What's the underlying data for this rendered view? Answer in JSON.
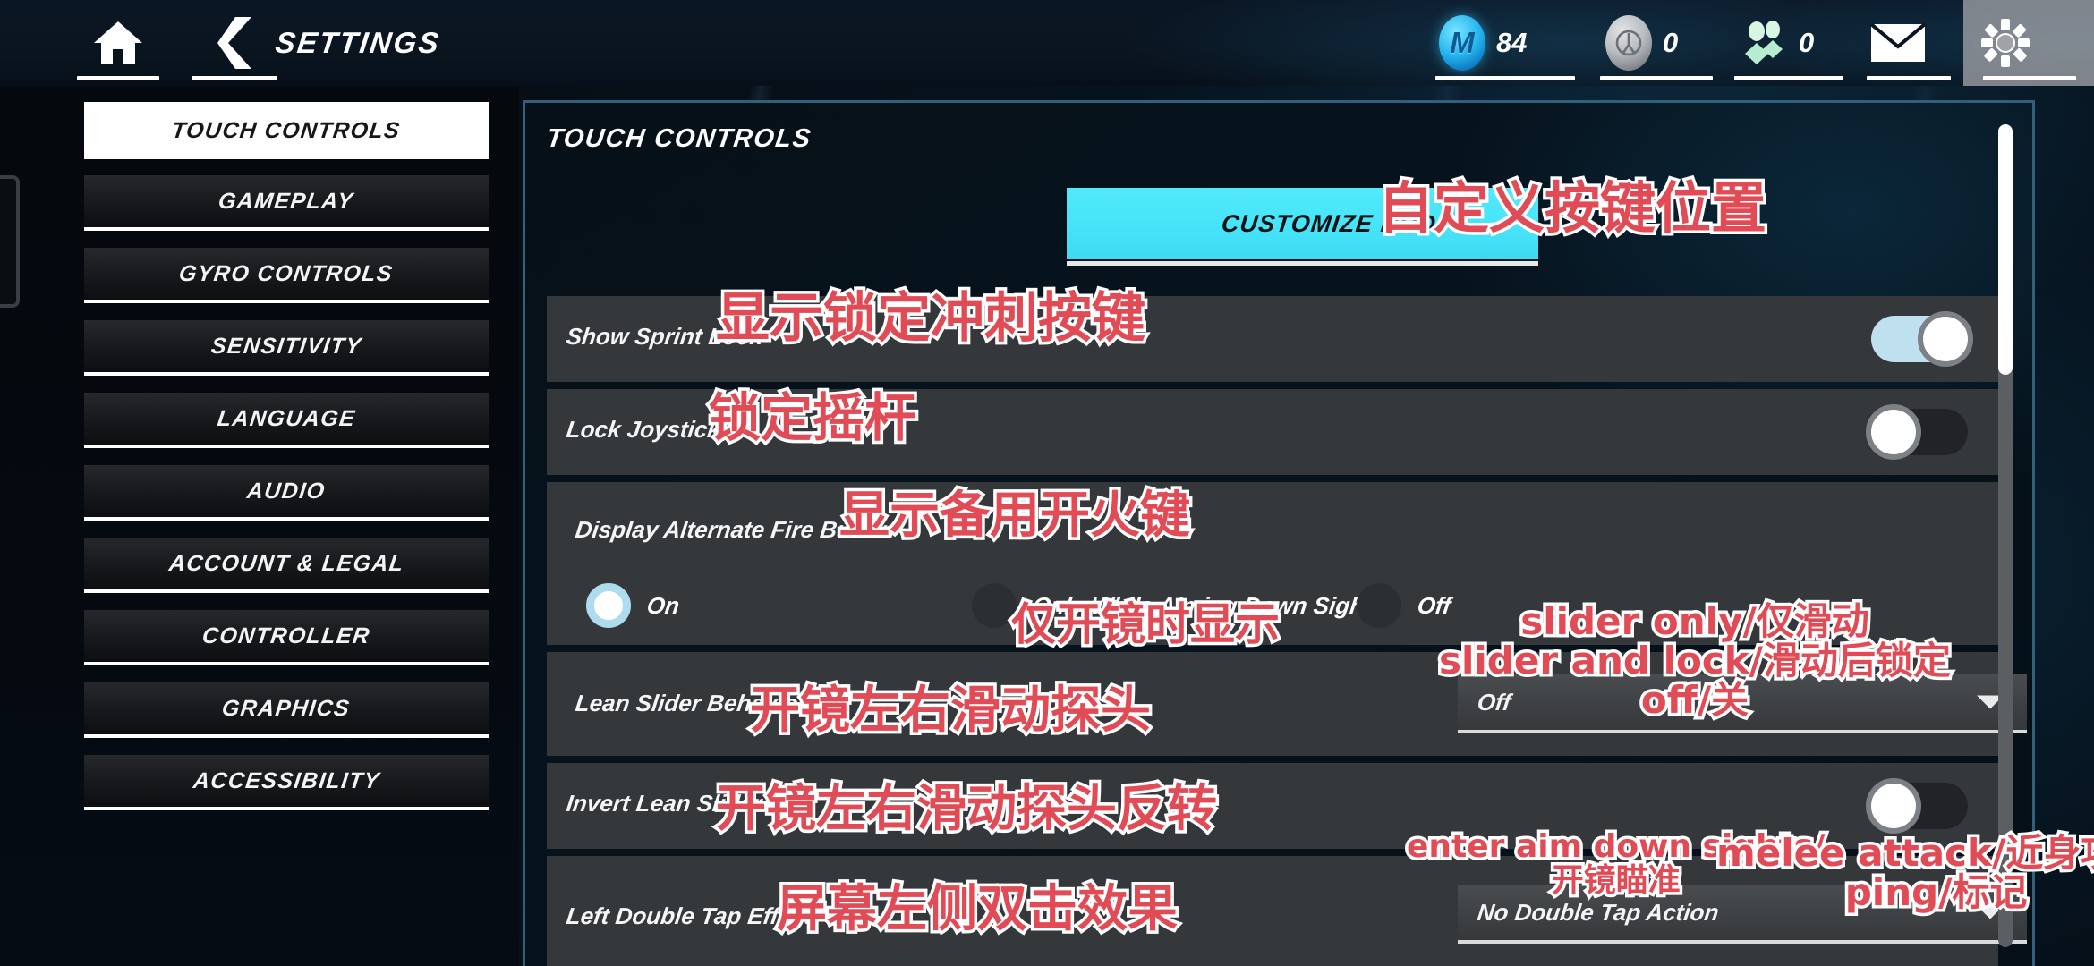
{
  "topbar": {
    "home_icon": "home-icon",
    "back_icon": "back-chevron-icon",
    "title": "SETTINGS",
    "currencies": [
      {
        "id": "credits",
        "icon": "m-credit-coin-icon",
        "glyph": "M",
        "value": "84"
      },
      {
        "id": "tokens",
        "icon": "r6-token-coin-icon",
        "glyph": "",
        "value": "0"
      },
      {
        "id": "friends",
        "icon": "friends-icon",
        "glyph": "",
        "value": "0"
      },
      {
        "id": "mail",
        "icon": "mail-envelope-icon",
        "glyph": "",
        "value": ""
      },
      {
        "id": "gear",
        "icon": "gear-icon",
        "glyph": "",
        "value": ""
      }
    ]
  },
  "sidebar": {
    "items": [
      {
        "label": "TOUCH CONTROLS",
        "active": true
      },
      {
        "label": "GAMEPLAY",
        "active": false
      },
      {
        "label": "GYRO CONTROLS",
        "active": false
      },
      {
        "label": "SENSITIVITY",
        "active": false
      },
      {
        "label": "LANGUAGE",
        "active": false
      },
      {
        "label": "AUDIO",
        "active": false
      },
      {
        "label": "ACCOUNT & LEGAL",
        "active": false
      },
      {
        "label": "CONTROLLER",
        "active": false
      },
      {
        "label": "GRAPHICS",
        "active": false
      },
      {
        "label": "ACCESSIBILITY",
        "active": false
      }
    ]
  },
  "main": {
    "panel_title": "TOUCH CONTROLS",
    "customize_hud_label": "CUSTOMIZE HUD",
    "rows": {
      "show_sprint_lock": {
        "label": "Show Sprint Lock",
        "toggle": "on"
      },
      "lock_joystick": {
        "label": "Lock Joystick",
        "toggle": "off"
      },
      "display_alternate_fire": {
        "label": "Display Alternate Fire Button",
        "options": [
          {
            "label": "On",
            "selected": true
          },
          {
            "label": "Only While Aiming Down Sight",
            "selected": false
          },
          {
            "label": "Off",
            "selected": false
          }
        ]
      },
      "lean_slider_behavior": {
        "label": "Lean Slider Behavior",
        "value": "Off"
      },
      "invert_lean_slider": {
        "label": "Invert Lean Slider",
        "toggle": "off"
      },
      "left_double_tap": {
        "label": "Left Double Tap Effect",
        "value": "No Double Tap Action"
      }
    }
  },
  "annotations": [
    {
      "id": "anno-customize-hud",
      "text": "自定义按键位置"
    },
    {
      "id": "anno-sprint-lock",
      "text": "显示锁定冲刺按键"
    },
    {
      "id": "anno-lock-joystick",
      "text": "锁定摇杆"
    },
    {
      "id": "anno-alt-fire",
      "text": "显示备用开火键"
    },
    {
      "id": "anno-ads-only",
      "text": "仅开镜时显示"
    },
    {
      "id": "anno-lean-behavior",
      "text": "开镜左右滑动探头"
    },
    {
      "id": "anno-lean-options",
      "text": "slider only/仅滑动\nslider and lock/滑动后锁定\noff/关"
    },
    {
      "id": "anno-invert-lean",
      "text": "开镜左右滑动探头反转"
    },
    {
      "id": "anno-left-dtap",
      "text": "屏幕左侧双击效果"
    },
    {
      "id": "anno-dtap-ads",
      "text": "enter aim down sights/\n开镜瞄准"
    },
    {
      "id": "anno-dtap-melee",
      "text": "melee attack/近身攻击\nping/标记"
    }
  ],
  "colors": {
    "accent_cyan": "#45e3f8",
    "annotation_red": "#e04b55",
    "annotation_outline": "#ffffff",
    "row_bg": "#35383b",
    "toggle_on_track": "#bfe0ee",
    "panel_border": "#3a6e8c"
  }
}
